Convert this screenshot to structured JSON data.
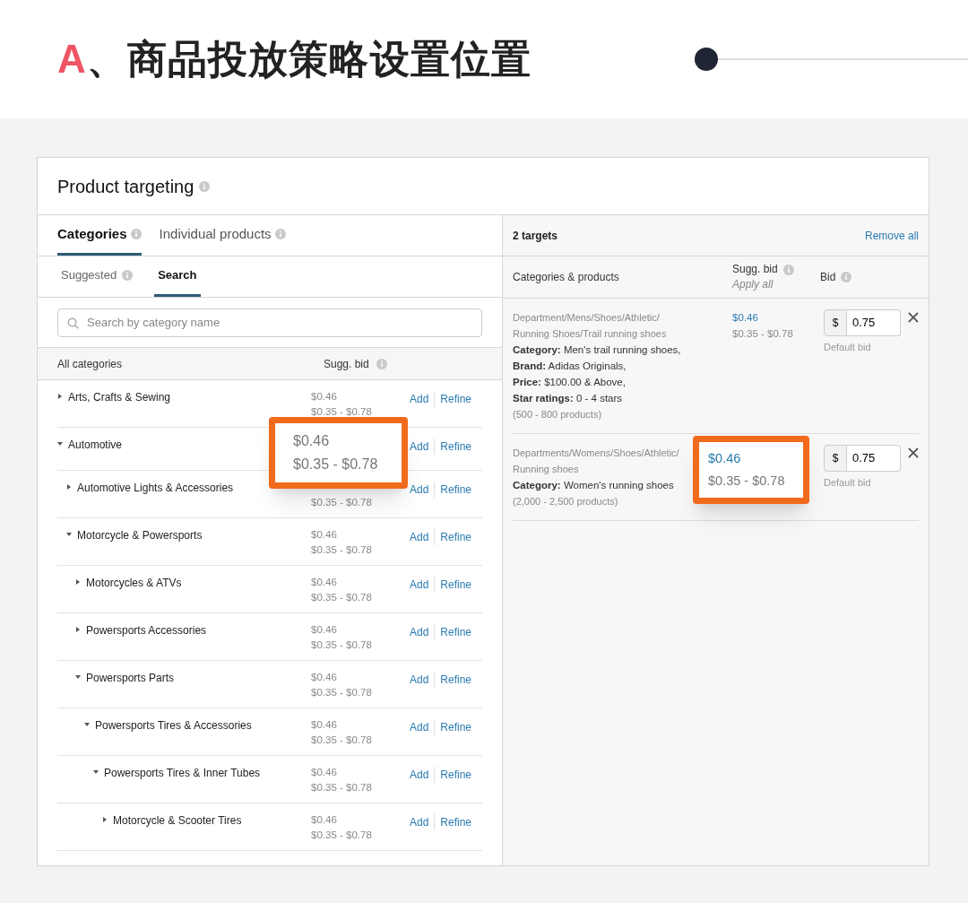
{
  "banner": {
    "marker": "A",
    "title": "、商品投放策略设置位置"
  },
  "panel": {
    "title": "Product targeting",
    "tabs": [
      {
        "label": "Categories",
        "selected": true
      },
      {
        "label": "Individual products",
        "selected": false
      }
    ],
    "subtabs": [
      {
        "label": "Suggested",
        "selected": false,
        "info": true
      },
      {
        "label": "Search",
        "selected": true,
        "info": false
      }
    ],
    "search": {
      "placeholder": "Search by category name"
    },
    "columns": [
      "All categories",
      "Sugg. bid"
    ],
    "categories": [
      {
        "name": "Arts, Crafts & Sewing",
        "expanded": false,
        "bid": "$0.46",
        "range": "$0.35 - $0.78",
        "highlighted": false,
        "add": "Add",
        "refine": "Refine"
      },
      {
        "name": "Automotive",
        "expanded": true,
        "bid": "$0.46",
        "range": "$0.35 - $0.78",
        "highlighted": true,
        "add": "Add",
        "refine": "Refine",
        "children": [
          {
            "name": "Automotive Lights & Accessories",
            "expanded": false,
            "range": "$0.35 - $0.78",
            "highlighted": false,
            "add": "Add",
            "refine": "Refine"
          },
          {
            "name": "Motorcycle & Powersports",
            "expanded": true,
            "bid": "$0.46",
            "range": "$0.35 - $0.78",
            "highlighted": false,
            "add": "Add",
            "refine": "Refine",
            "children": [
              {
                "name": "Motorcycles & ATVs",
                "expanded": false,
                "bid": "$0.46",
                "range": "$0.35 - $0.78",
                "highlighted": false,
                "add": "Add",
                "refine": "Refine"
              },
              {
                "name": "Powersports Accessories",
                "expanded": false,
                "bid": "$0.46",
                "range": "$0.35 - $0.78",
                "highlighted": false,
                "add": "Add",
                "refine": "Refine"
              },
              {
                "name": "Powersports Parts",
                "expanded": true,
                "bid": "$0.46",
                "range": "$0.35 - $0.78",
                "highlighted": false,
                "add": "Add",
                "refine": "Refine",
                "children": [
                  {
                    "name": "Powersports Tires & Accessories",
                    "expanded": true,
                    "bid": "$0.46",
                    "range": "$0.35 - $0.78",
                    "highlighted": false,
                    "add": "Add",
                    "refine": "Refine",
                    "children": [
                      {
                        "name": "Powersports Tires & Inner Tubes",
                        "expanded": true,
                        "bid": "$0.46",
                        "range": "$0.35 - $0.78",
                        "highlighted": false,
                        "add": "Add",
                        "refine": "Refine",
                        "children": [
                          {
                            "name": "Motorcycle & Scooter Tires",
                            "expanded": false,
                            "bid": "$0.46",
                            "range": "$0.35 - $0.78",
                            "highlighted": false,
                            "add": "Add",
                            "refine": "Refine"
                          }
                        ]
                      }
                    ]
                  }
                ]
              }
            ]
          }
        ]
      }
    ],
    "targets_header": {
      "count": "2 targets",
      "remove_all": "Remove all"
    },
    "target_columns": {
      "item": "Categories & products",
      "sugg": "Sugg. bid",
      "apply_all": "Apply all",
      "bid": "Bid"
    },
    "targets": [
      {
        "path": "Department/Mens/Shoes/Athletic/ Running Shoes/Trail running shoes",
        "details": [
          "**Category:** Men's trail running shoes,",
          "**Brand:** Adidas Originals,",
          "**Price:** $100.00 & Above,",
          "**Star ratings:** 0 - 4 stars"
        ],
        "count": "(500 - 800 products)",
        "bid": "$0.46",
        "range": "$0.35 - $0.78",
        "highlighted": false,
        "currency": "$",
        "value": "0.75",
        "hint": "Default bid"
      },
      {
        "path": "Departments/Womens/Shoes/Athletic/ Running shoes",
        "details": [
          "**Category:** Women's running shoes"
        ],
        "count": "(2,000 - 2,500 products)",
        "bid": "$0.46",
        "range": "$0.35 - $0.78",
        "highlighted": true,
        "currency": "$",
        "value": "0.75",
        "hint": "Default bid"
      }
    ]
  }
}
